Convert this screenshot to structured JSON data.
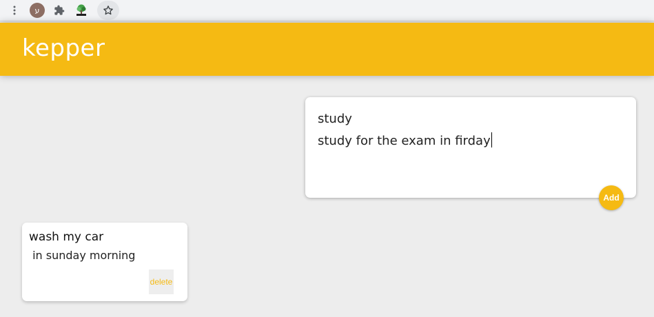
{
  "browser": {
    "avatar_initial": "ע",
    "icons": [
      "menu-dots-icon",
      "extensions-icon",
      "tree-extension-icon",
      "bookmark-star-icon"
    ]
  },
  "header": {
    "title": "kepper"
  },
  "create_note": {
    "title_value": "study",
    "content_value": "study for the exam in firday",
    "add_label": "Add"
  },
  "notes": [
    {
      "title": "wash my car",
      "content": " in sunday morning",
      "delete_label": "delete"
    }
  ],
  "colors": {
    "accent": "#f5ba13",
    "background": "#ededed",
    "card": "#ffffff"
  }
}
